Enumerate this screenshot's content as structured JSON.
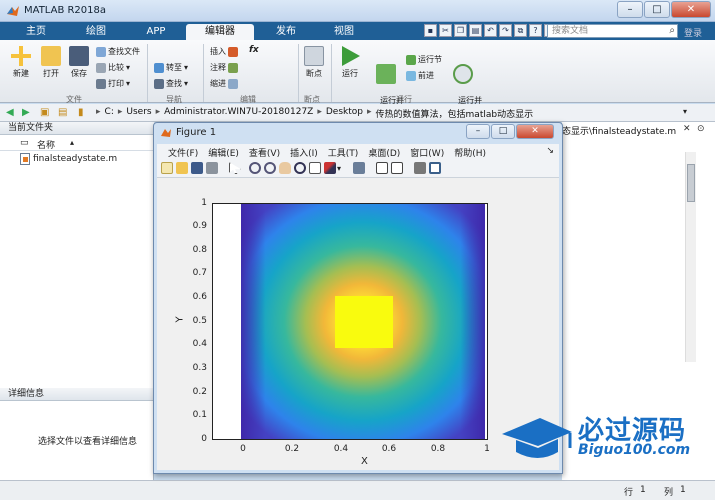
{
  "window": {
    "title": "MATLAB R2018a",
    "min": "–",
    "max": "□",
    "close": "✕"
  },
  "tabs": [
    "主页",
    "绘图",
    "APP",
    "编辑器",
    "发布",
    "视图"
  ],
  "active_tab": "编辑器",
  "search": {
    "placeholder": "搜索文档",
    "login": "登录"
  },
  "ribbon": {
    "new": "新建",
    "open": "打开",
    "save": "保存",
    "find_files": "查找文件",
    "compare": "比较",
    "print": "打印",
    "goto": "转至",
    "find": "查找",
    "insert": "插入",
    "fx": "fx",
    "comment": "注释",
    "indent": "缩进",
    "breakpoints": "断点",
    "run": "运行",
    "run_advance": "运行并\n前进",
    "run_section": "运行节",
    "advance": "前进",
    "run_time": "运行并\n计时",
    "groups": {
      "file": "文件",
      "navigate": "导航",
      "edit": "编辑",
      "breakpoints": "断点",
      "run": "运行"
    }
  },
  "address": {
    "crumbs": [
      "C:",
      "Users",
      "Administrator.WIN7U-20180127Z",
      "Desktop",
      "传热的数值算法，包括matlab动态显示"
    ]
  },
  "left_panel": {
    "header": "当前文件夹",
    "column": "名称",
    "files": [
      "finalsteadystate.m"
    ],
    "details_header": "详细信息",
    "details_text": "选择文件以查看详细信息"
  },
  "right_panel": {
    "path": "态显示\\finalsteadystate.m"
  },
  "figure": {
    "title": "Figure 1",
    "menu": [
      "文件(F)",
      "编辑(E)",
      "查看(V)",
      "插入(I)",
      "工具(T)",
      "桌面(D)",
      "窗口(W)",
      "帮助(H)"
    ],
    "xlabel": "X",
    "ylabel": "Y",
    "xticks": [
      "0",
      "0.2",
      "0.4",
      "0.6",
      "0.8",
      "1"
    ],
    "yticks": [
      "1",
      "0.9",
      "0.8",
      "0.7",
      "0.6",
      "0.5",
      "0.4",
      "0.3",
      "0.2",
      "0.1",
      "0"
    ]
  },
  "status": {
    "row_label": "行",
    "row": "1",
    "col_label": "列",
    "col": "1"
  },
  "watermark": {
    "text": "必过源码",
    "url": "Biguo100.com"
  },
  "colors": {
    "tab_bar": "#1f5f96",
    "heat_low": "#3e26a8",
    "heat_high": "#f9fb0e"
  }
}
